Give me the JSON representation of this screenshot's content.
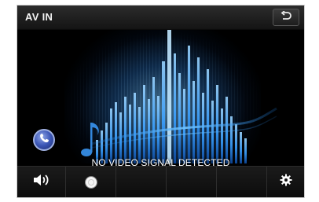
{
  "header": {
    "title": "AV IN",
    "back_icon": "back-arrow-icon"
  },
  "main": {
    "message": "NO VIDEO SIGNAL DETECTED",
    "phone_icon": "phone-icon"
  },
  "bottom_bar": {
    "volume_icon": "speaker-volume-icon",
    "source_icon": "disc-icon",
    "settings_icon": "gear-icon"
  },
  "colors": {
    "background": "#000000",
    "accent_blue": "#3ba4ff",
    "phone_button": "#3b56b6",
    "text": "#ffffff"
  }
}
